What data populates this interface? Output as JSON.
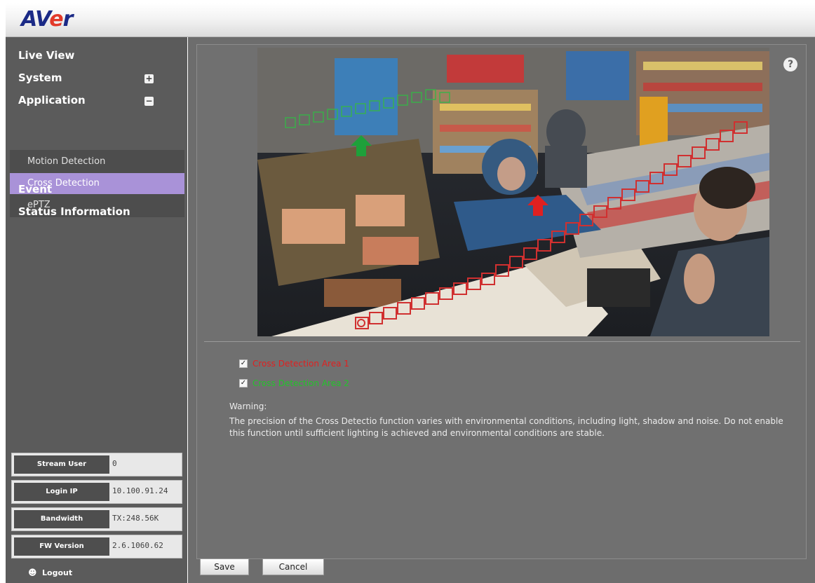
{
  "header": {
    "logo_text_start": "AV",
    "logo_text_accent": "e",
    "logo_text_end": "r",
    "logo_colors": {
      "main": "#1b2a86",
      "accent": "#e23a2a"
    }
  },
  "sidebar": {
    "items": [
      {
        "label": "Live View"
      },
      {
        "label": "System",
        "toggle": "+"
      },
      {
        "label": "Application",
        "toggle": "−"
      }
    ],
    "submenu": [
      {
        "label": "Motion Detection"
      },
      {
        "label": "Cross Detection",
        "active": true
      },
      {
        "label": "ePTZ"
      }
    ],
    "items_after": [
      {
        "label": "Event"
      },
      {
        "label": "Status Information"
      }
    ],
    "info": [
      {
        "label": "Stream User",
        "value": "0"
      },
      {
        "label": "Login IP",
        "value": "10.100.91.24"
      },
      {
        "label": "Bandwidth",
        "value": "TX:248.56K"
      },
      {
        "label": "FW Version",
        "value": "2.6.1060.62"
      }
    ],
    "logout_label": "Logout",
    "active_color": "#a992d8"
  },
  "main": {
    "help_icon": "?",
    "areas": [
      {
        "label": "Cross Detection Area 1",
        "checked": true,
        "color": "#e02020"
      },
      {
        "label": "Cross Detection Area 2",
        "checked": true,
        "color": "#22c42a"
      }
    ],
    "warning_title": "Warning:",
    "warning_text": "The precision of the Cross Detectio function varies with environmental conditions, including light, shadow and noise. Do not enable this function until sufficient lighting is achieved and environmental conditions are stable.",
    "save_label": "Save",
    "cancel_label": "Cancel"
  }
}
